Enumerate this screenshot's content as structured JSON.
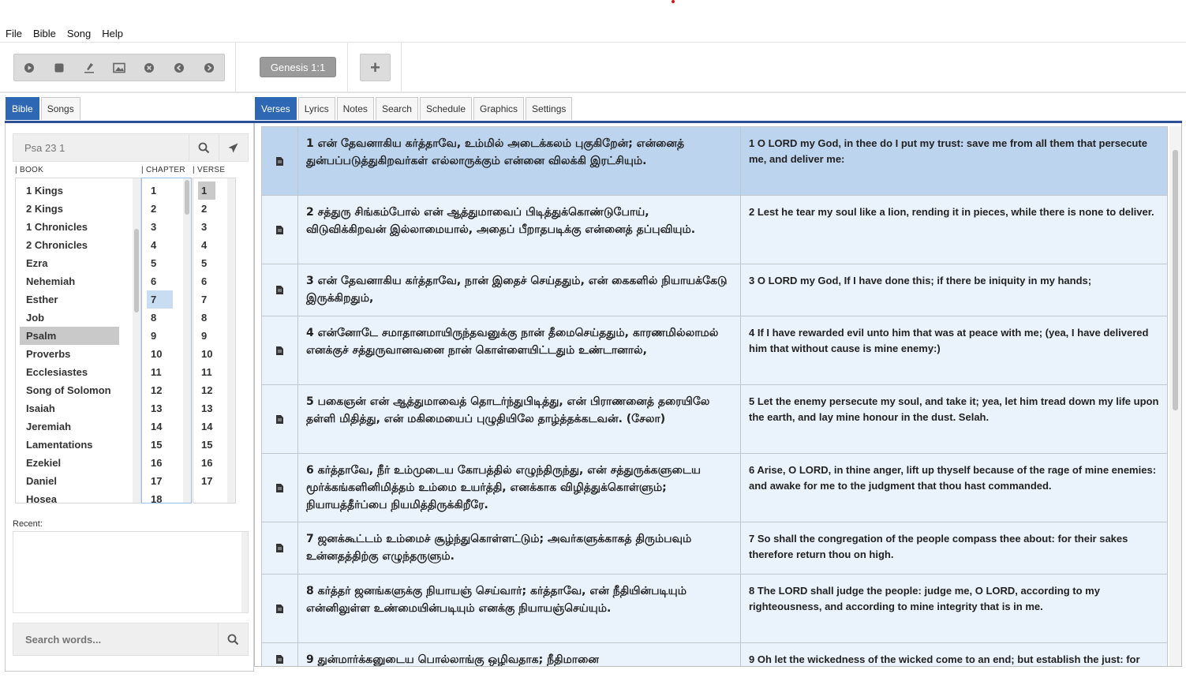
{
  "menu": [
    "File",
    "Bible",
    "Song",
    "Help"
  ],
  "toolbar": {
    "controls": [
      {
        "name": "play-icon",
        "glyph": "▶"
      },
      {
        "name": "stop-icon",
        "glyph": "■"
      },
      {
        "name": "brush-icon",
        "glyph": "✎"
      },
      {
        "name": "image-icon",
        "glyph": "▣"
      },
      {
        "name": "clear-icon",
        "glyph": "✕"
      },
      {
        "name": "previous-icon",
        "glyph": "◀"
      },
      {
        "name": "next-icon",
        "glyph": "▶"
      }
    ],
    "current_reference": "Genesis 1:1",
    "add_label": "+"
  },
  "left": {
    "tabs": [
      "Bible",
      "Songs"
    ],
    "search_placeholder": "Psa 23 1",
    "col_book": "| BOOK",
    "col_chapter": "| CHAPTER",
    "col_verse": "| VERSE",
    "books": [
      "1 Kings",
      "2 Kings",
      "1 Chronicles",
      "2 Chronicles",
      "Ezra",
      "Nehemiah",
      "Esther",
      "Job",
      "Psalm",
      "Proverbs",
      "Ecclesiastes",
      "Song of Solomon",
      "Isaiah",
      "Jeremiah",
      "Lamentations",
      "Ezekiel",
      "Daniel",
      "Hosea"
    ],
    "selected_book": "Psalm",
    "chapters": [
      "1",
      "2",
      "3",
      "4",
      "5",
      "6",
      "7",
      "8",
      "9",
      "10",
      "11",
      "12",
      "13",
      "14",
      "15",
      "16",
      "17",
      "18"
    ],
    "selected_chapter": "7",
    "verses": [
      "1",
      "2",
      "3",
      "4",
      "5",
      "6",
      "7",
      "8",
      "9",
      "10",
      "11",
      "12",
      "13",
      "14",
      "15",
      "16",
      "17"
    ],
    "selected_verse": "1",
    "recent_label": "Recent:",
    "word_search_placeholder": "Search words..."
  },
  "right": {
    "tabs": [
      "Verses",
      "Lyrics",
      "Notes",
      "Search",
      "Schedule",
      "Graphics",
      "Settings"
    ],
    "active_tab": "Verses",
    "rows": [
      {
        "ta": "1 என் தேவனாகிய கர்த்தாவே, உம்மில் அடைக்கலம் புகுகிறேன்; என்னைத் துன்பப்படுத்துகிறவர்கள் எல்லாருக்கும் என்னை விலக்கி இரட்சியும்.",
        "en": "1 O LORD my God, in thee do I put my trust: save me from all them that persecute me, and deliver me:"
      },
      {
        "ta": "2 சத்துரு சிங்கம்போல் என் ஆத்துமாவைப் பிடித்துக்கொண்டுபோய், விடுவிக்கிறவன் இல்லாமையால், அதைப் பீறாதபடிக்கு என்னைத் தப்புவியும்.",
        "en": "2 Lest he tear my soul like a lion, rending it in pieces, while there is none to deliver."
      },
      {
        "ta": "3 என் தேவனாகிய கர்த்தாவே, நான் இதைச் செய்ததும், என் கைகளில் நியாயக்கேடு இருக்கிறதும்,",
        "en": "3 O LORD my God, If I have done this; if there be iniquity in my hands;"
      },
      {
        "ta": "4 என்னோடே சமாதானமாயிருந்தவனுக்கு நான் தீமைசெய்ததும், காரணமில்லாமல் எனக்குச் சத்துருவானவனை நான் கொள்ளையிட்டதும் உண்டானால்,",
        "en": "4 If I have rewarded evil unto him that was at peace with me; (yea, I have delivered him that without cause is mine enemy:)"
      },
      {
        "ta": "5 பகைஞன் என் ஆத்துமாவைத் தொடர்ந்துபிடித்து, என் பிராணனைத் தரையிலே தள்ளி மிதித்து, என் மகிமையைப் புழுதியிலே தாழ்த்தக்கடவன். (சேலா)",
        "en": "5 Let the enemy persecute my soul, and take it; yea, let him tread down my life upon the earth, and lay mine honour in the dust. Selah."
      },
      {
        "ta": "6 கர்த்தாவே, நீர் உம்முடைய கோபத்தில் எழுந்திருந்து, என் சத்துருக்களுடைய மூர்க்கங்களினிமித்தம் உம்மை உயர்த்தி, எனக்காக விழித்துக்கொள்ளும்; நியாயத்தீர்ப்பை நியமித்திருக்கிறீரே.",
        "en": "6 Arise, O LORD, in thine anger, lift up thyself because of the rage of mine enemies: and awake for me to the judgment that thou hast commanded."
      },
      {
        "ta": "7 ஜனக்கூட்டம் உம்மைச் சூழ்ந்துகொள்ளட்டும்; அவர்களுக்காகத் திரும்பவும் உன்னதத்திற்கு எழுந்தருளும்.",
        "en": "7 So shall the congregation of the people compass thee about: for their sakes therefore return thou on high."
      },
      {
        "ta": "8 கர்த்தர் ஜனங்களுக்கு நியாயஞ் செய்வார்; கர்த்தாவே, என் நீதியின்படியும் என்னிலுள்ள உண்மையின்படியும் எனக்கு நியாயஞ்செய்யும்.",
        "en": "8 The LORD shall judge the people: judge me, O LORD, according to my righteousness, and according to mine integrity that is in me."
      },
      {
        "ta": "9 துன்மார்க்கனுடைய பொல்லாங்கு ஒழிவதாக; நீதிமானை",
        "en": "9 Oh let the wickedness of the wicked come to an end; but establish the just: for"
      }
    ]
  },
  "colors": {
    "accent": "#2e67b3",
    "selected_row": "#bdd4ee",
    "row": "#eaf3fc"
  }
}
